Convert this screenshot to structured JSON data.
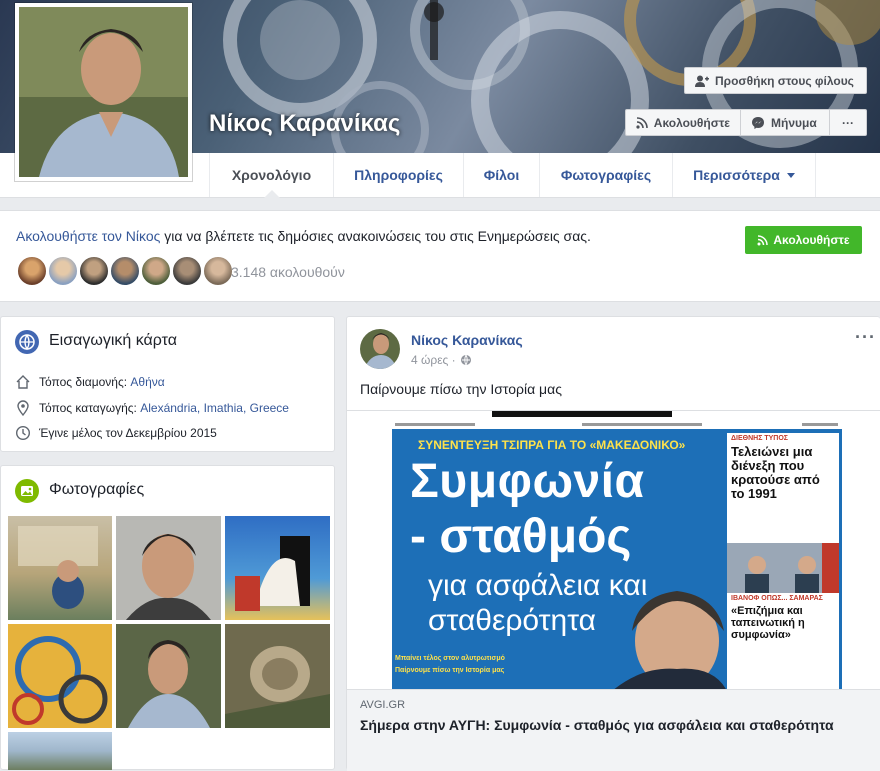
{
  "profile": {
    "name": "Νίκος Καρανίκας"
  },
  "cover_buttons": {
    "add_friend": "Προσθήκη στους φίλους",
    "follow": "Ακολουθήστε",
    "message": "Μήνυμα",
    "more": "···"
  },
  "tabs": [
    {
      "label": "Χρονολόγιο",
      "active": true
    },
    {
      "label": "Πληροφορίες"
    },
    {
      "label": "Φίλοι"
    },
    {
      "label": "Φωτογραφίες"
    },
    {
      "label": "Περισσότερα"
    }
  ],
  "follow_strip": {
    "link_text": "Ακολουθήστε τον Νίκος",
    "rest_text": " για να βλέπετε τις δημόσιες ανακοινώσεις του στις Ενημερώσεις σας.",
    "button_label": "Ακολουθήστε",
    "followers_count": "3.148 ακολουθούν"
  },
  "intro": {
    "title": "Εισαγωγική κάρτα",
    "lives_label": "Τόπος διαμονής: ",
    "lives_value": "Αθήνα",
    "from_label": "Τόπος καταγωγής: ",
    "from_value": "Alexándria, Imathia, Greece",
    "joined": "Έγινε μέλος τον Δεκεμβρίου 2015"
  },
  "photos": {
    "title": "Φωτογραφίες"
  },
  "post": {
    "author": "Νίκος Καρανίκας",
    "time": "4 ώρες ·",
    "menu": "···",
    "text": "Παίρνουμε πίσω την Ιστορία μας",
    "newspaper": {
      "kicker": "ΣΥΝΕΝΤΕΥΞΗ ΤΣΙΠΡΑ ΓΙΑ ΤΟ «ΜΑΚΕΔΟΝΙΚΟ»",
      "headline1": "Συμφωνία",
      "headline2": "- σταθμός",
      "sub1": "για ασφάλεια και",
      "sub2": "σταθερότητα",
      "side_tag": "ΔΙΕΘΝΗΣ ΤΥΠΟΣ",
      "side_title": "Τελειώνει μια διένεξη που κρατούσε από το 1991",
      "side_tag2": "ΙΒΑΝΟΦ ΟΠΩΣ... ΣΑΜΑΡΑΣ",
      "side_title2": "«Επιζήμια και ταπεινωτική η συμφωνία»",
      "foot1": "Μπαίνει τέλος στον αλυτρωτισμό",
      "foot2": "Παίρνουμε πίσω την Ιστορία μας"
    },
    "link_domain": "AVGI.GR",
    "link_title": "Σήμερα στην ΑΥΓΗ: Συμφωνία - σταθμός για ασφάλεια και σταθερότητα"
  },
  "colors": {
    "fb_blue": "#365899",
    "green": "#42b72a",
    "bg": "#e9ebee",
    "newspaper_blue": "#1d6fb7"
  }
}
